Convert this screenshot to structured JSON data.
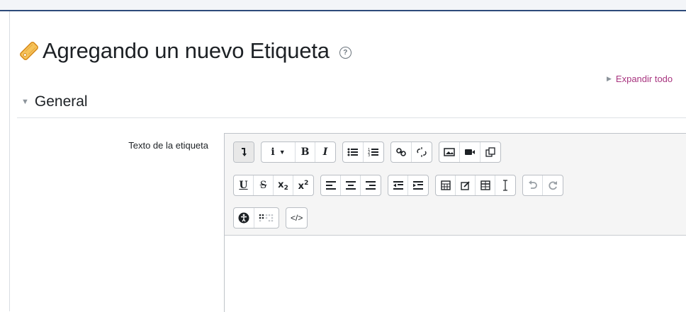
{
  "page": {
    "title": "Agregando un nuevo Etiqueta",
    "help_icon_glyph": "?",
    "expand_all": "Expandir todo"
  },
  "section": {
    "title": "General"
  },
  "field": {
    "label": "Texto de la etiqueta"
  },
  "toolbar": {
    "rows": [
      [
        [
          "toggle-toolbar-icon"
        ],
        [
          "paragraph-style-icon",
          "bold-icon",
          "italic-icon"
        ],
        [
          "unordered-list-icon",
          "ordered-list-icon"
        ],
        [
          "link-icon",
          "unlink-icon"
        ],
        [
          "image-icon",
          "video-icon",
          "manage-files-icon"
        ]
      ],
      [
        [
          "underline-icon",
          "strikethrough-icon",
          "subscript-icon",
          "superscript-icon"
        ],
        [
          "align-left-icon",
          "align-center-icon",
          "align-right-icon"
        ],
        [
          "outdent-icon",
          "indent-icon"
        ],
        [
          "equation-icon",
          "special-character-icon",
          "table-icon",
          "clear-formatting-icon"
        ],
        [
          "undo-icon",
          "redo-icon"
        ]
      ],
      [
        [
          "accessibility-checker-icon",
          "screenreader-helper-icon"
        ],
        [
          "html-source-icon"
        ]
      ]
    ],
    "labels": {
      "bold": "B",
      "italic": "I",
      "underline": "U",
      "strike": "S",
      "sub_base": "x",
      "sub_index": "2",
      "sup_base": "x",
      "sup_index": "2",
      "para": "i",
      "html": "</>"
    }
  },
  "colors": {
    "accent_link": "#a8347f",
    "title_icon": "#f0a32b",
    "header_rule": "#2d4a7a"
  }
}
